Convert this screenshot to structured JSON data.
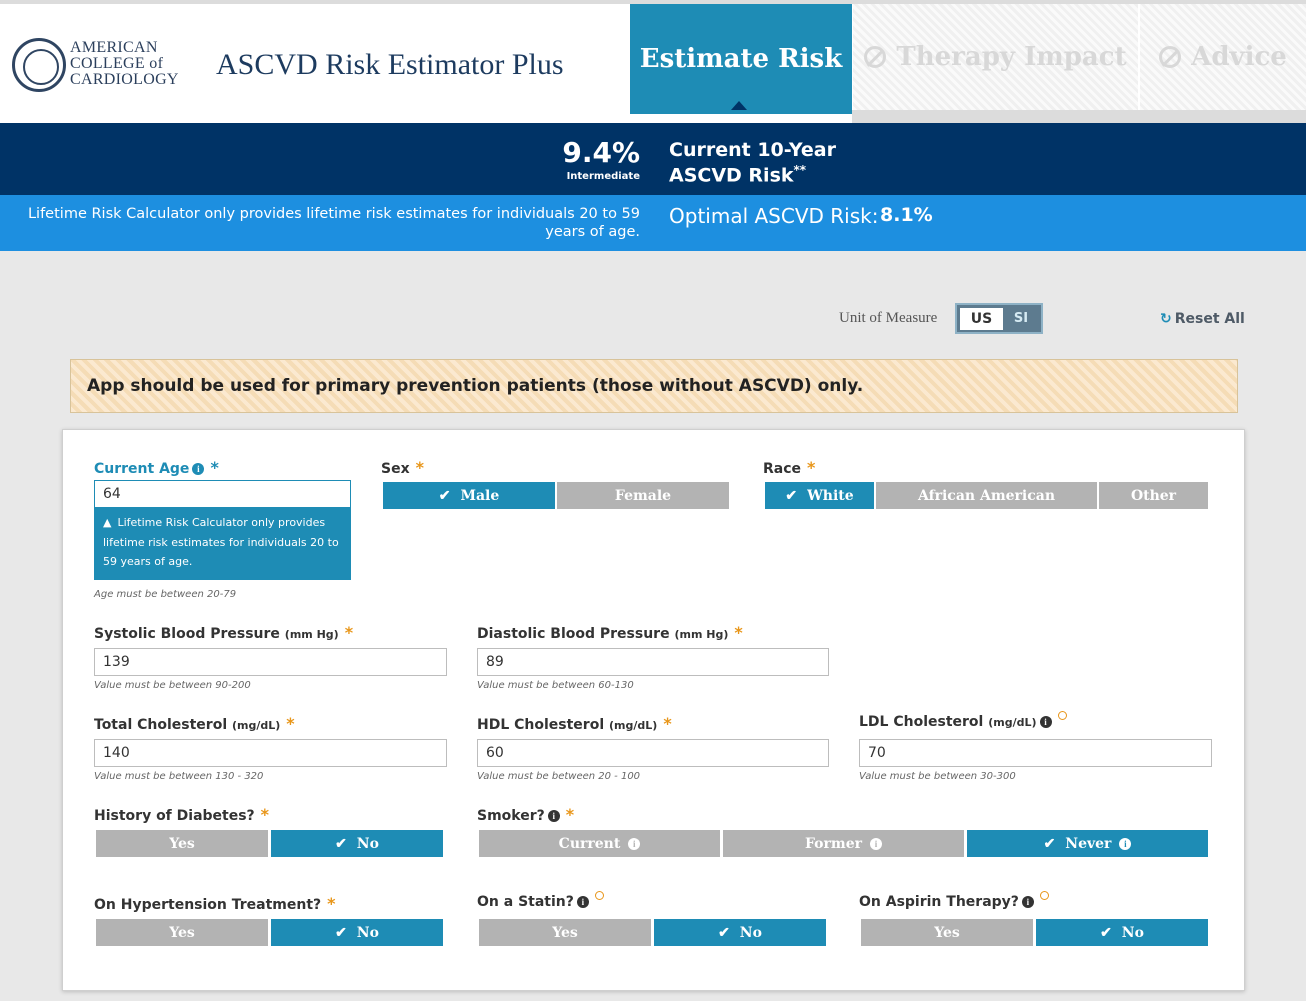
{
  "header": {
    "logo_lines": [
      "AMERICAN",
      "COLLEGE of",
      "CARDIOLOGY"
    ],
    "app_title": "ASCVD Risk Estimator Plus",
    "tabs": [
      {
        "label": "Estimate Risk",
        "active": true
      },
      {
        "label": "Therapy Impact",
        "disabled": true
      },
      {
        "label": "Advice",
        "disabled": true
      }
    ]
  },
  "risk": {
    "value": "9.4%",
    "level": "Intermediate",
    "label_line1": "Current 10-Year",
    "label_line2": "ASCVD Risk",
    "label_suffix": "**",
    "lifetime_msg": "Lifetime Risk Calculator only provides lifetime risk estimates for individuals 20 to 59 years of age.",
    "optimal_label": "Optimal ASCVD Risk:",
    "optimal_value": "8.1%"
  },
  "controls": {
    "unit_label": "Unit of Measure",
    "unit_us": "US",
    "unit_si": "SI",
    "unit_selected": "US",
    "reset": "Reset All"
  },
  "warning": "App should be used for primary prevention patients (those without ASCVD) only.",
  "form": {
    "age": {
      "label": "Current Age",
      "value": "64",
      "alert": "Lifetime Risk Calculator only provides lifetime risk estimates for individuals 20 to 59 years of age.",
      "hint": "Age must be between 20-79"
    },
    "sex": {
      "label": "Sex",
      "options": [
        "Male",
        "Female"
      ],
      "selected": "Male"
    },
    "race": {
      "label": "Race",
      "options": [
        "White",
        "African American",
        "Other"
      ],
      "selected": "White"
    },
    "sbp": {
      "label": "Systolic Blood Pressure",
      "unit": "(mm Hg)",
      "value": "139",
      "hint": "Value must be between 90-200"
    },
    "dbp": {
      "label": "Diastolic Blood Pressure",
      "unit": "(mm Hg)",
      "value": "89",
      "hint": "Value must be between 60-130"
    },
    "tc": {
      "label": "Total Cholesterol",
      "unit": "(mg/dL)",
      "value": "140",
      "hint": "Value must be between 130 - 320"
    },
    "hdl": {
      "label": "HDL Cholesterol",
      "unit": "(mg/dL)",
      "value": "60",
      "hint": "Value must be between 20 - 100"
    },
    "ldl": {
      "label": "LDL Cholesterol",
      "unit": "(mg/dL)",
      "value": "70",
      "hint": "Value must be between 30-300"
    },
    "diabetes": {
      "label": "History of Diabetes?",
      "options": [
        "Yes",
        "No"
      ],
      "selected": "No"
    },
    "smoker": {
      "label": "Smoker?",
      "options": [
        "Current",
        "Former",
        "Never"
      ],
      "selected": "Never"
    },
    "htn": {
      "label": "On Hypertension Treatment?",
      "options": [
        "Yes",
        "No"
      ],
      "selected": "No"
    },
    "statin": {
      "label": "On a Statin?",
      "options": [
        "Yes",
        "No"
      ],
      "selected": "No"
    },
    "aspirin": {
      "label": "On Aspirin Therapy?",
      "options": [
        "Yes",
        "No"
      ],
      "selected": "No"
    }
  },
  "colors": {
    "primary": "#1e8cb5",
    "navy": "#003366",
    "lifebar": "#1d8fe0",
    "required": "#e8961a",
    "inactive": "#b3b3b3"
  }
}
